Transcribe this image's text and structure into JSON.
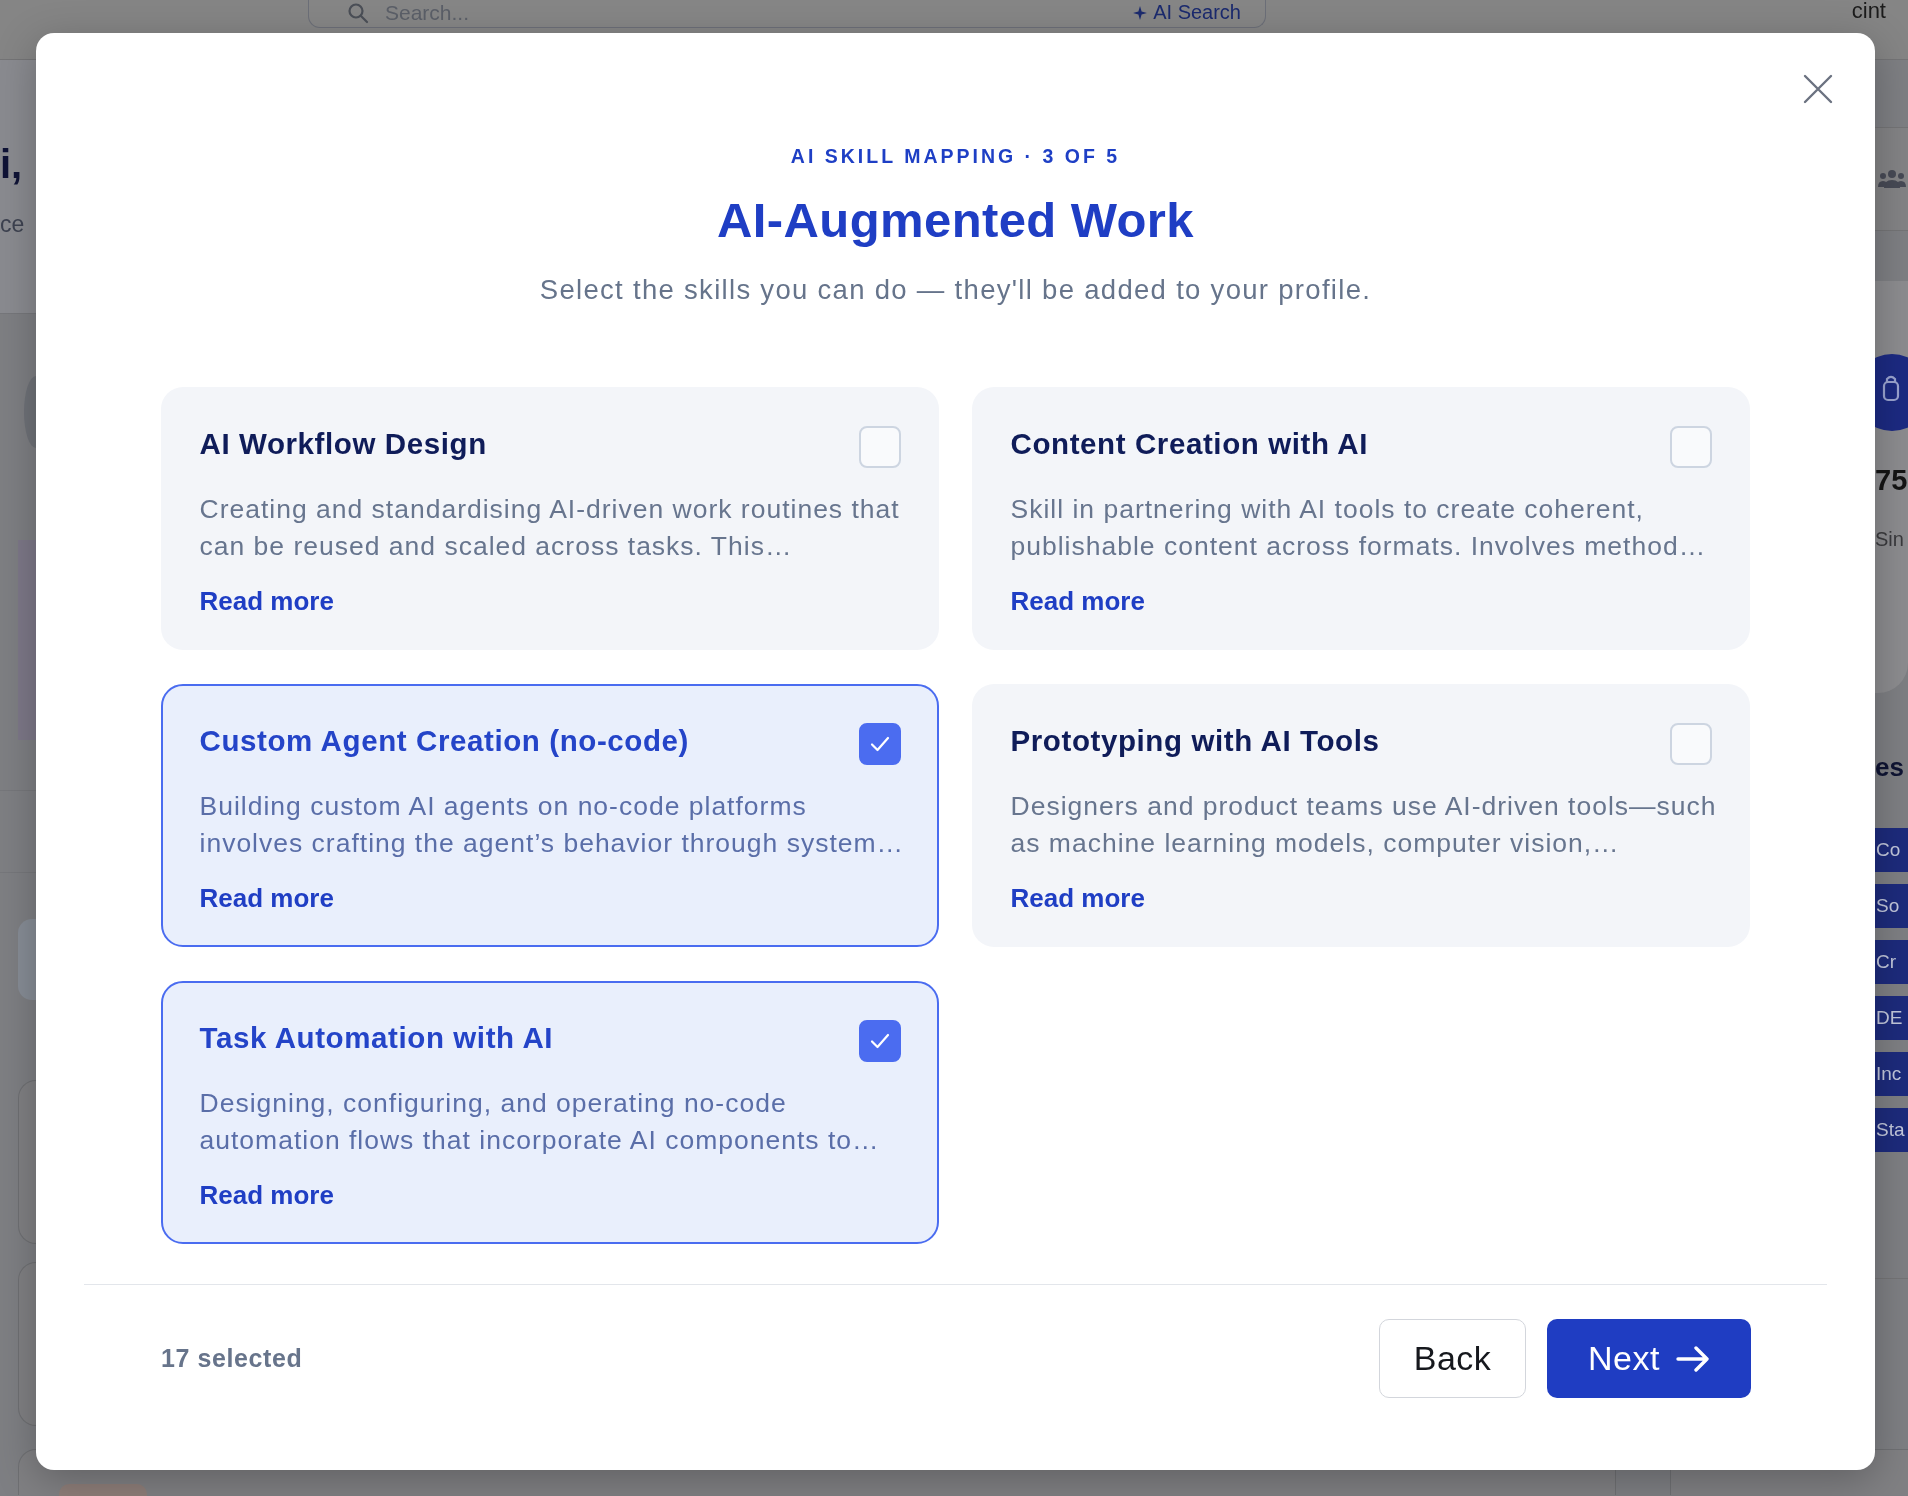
{
  "background_page": {
    "top_bar": {
      "search": {
        "placeholder": "Search..."
      },
      "ai_search_label": "AI Search",
      "corner_text": "cint"
    },
    "left_edge": {
      "greeting": "i,",
      "subtitle": "ce"
    },
    "right_edge": {
      "stat_value": "75",
      "stat_label": "Sin",
      "section_heading": "es",
      "chips": [
        "Co",
        "So",
        "Cr",
        "DE",
        "Inc",
        "Sta"
      ]
    }
  },
  "modal": {
    "eyebrow": "AI SKILL MAPPING · 3 OF 5",
    "title": "AI-Augmented Work",
    "subtitle": "Select the skills you can do — they'll be added to your profile.",
    "skills": [
      {
        "name": "AI Workflow Design",
        "description": "Creating and standardising AI-driven work routines that can be reused and scaled across tasks. This…",
        "link": "Read more",
        "selected": false
      },
      {
        "name": "Content Creation with AI",
        "description": "Skill in partnering with AI tools to create coherent, publishable content across formats. Involves method…",
        "link": "Read more",
        "selected": false
      },
      {
        "name": "Custom Agent Creation (no-code)",
        "description": "Building custom AI agents on no-code platforms involves crafting the agent’s behavior through system…",
        "link": "Read more",
        "selected": true
      },
      {
        "name": "Prototyping with AI Tools",
        "description": "Designers and product teams use AI-driven tools—such as machine learning models, computer vision,…",
        "link": "Read more",
        "selected": false
      },
      {
        "name": "Task Automation with AI",
        "description": "Designing, configuring, and operating no-code automation flows that incorporate AI components to…",
        "link": "Read more",
        "selected": true
      }
    ],
    "selected_count": "17 selected",
    "buttons": [
      {
        "kind": "secondary",
        "label": "Back"
      },
      {
        "kind": "primary",
        "label": "Next"
      }
    ]
  }
}
